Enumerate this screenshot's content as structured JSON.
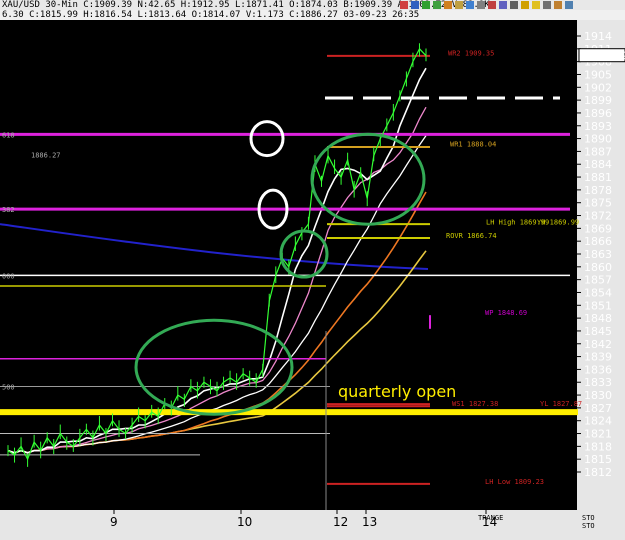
{
  "toolbar": {
    "ohlc": "XAU/USD 30-Min C:1909.39 N:42.65 H:1912.95 L:1871.41 O:1874.03 B:1909.39 A:1909.72 V:83.9K",
    "status": "6.30  C:1815.99 H:1816.54 L:1813.64 O:1814.07 V:1.173 C:1886.27 03-09-23 26:35",
    "icon_names": [
      "square-icon",
      "tile-icon",
      "arrow-icon",
      "check-icon",
      "refresh-icon",
      "notes-icon",
      "chart-icon",
      "settings-icon",
      "mail-icon",
      "grid-icon",
      "zoom-icon",
      "tag-icon",
      "sun-icon",
      "print-icon",
      "bell-icon",
      "window-icon"
    ]
  },
  "chart_data": {
    "type": "line",
    "symbol": "XAU/USD",
    "timeframe": "30-Min",
    "ylim": [
      1807,
      1917
    ],
    "y_ticks": [
      1914,
      1911,
      1908,
      1905,
      1902,
      1899,
      1896,
      1893,
      1890,
      1887,
      1884,
      1881,
      1878,
      1875,
      1872,
      1869,
      1866,
      1863,
      1860,
      1857,
      1854,
      1851,
      1848,
      1845,
      1842,
      1839,
      1836,
      1833,
      1830,
      1827,
      1824,
      1821,
      1818,
      1815,
      1812
    ],
    "last_price": "1909.39",
    "x_tick_labels": [
      "9",
      "10",
      "12",
      "13",
      "14"
    ],
    "close_series": [
      1817,
      1816,
      1818,
      1815,
      1819,
      1817,
      1820,
      1818,
      1821,
      1819,
      1818,
      1820,
      1822,
      1820,
      1823,
      1821,
      1824,
      1822,
      1821,
      1823,
      1825,
      1824,
      1826,
      1825,
      1828,
      1827,
      1830,
      1829,
      1832,
      1831,
      1833,
      1832,
      1831,
      1833,
      1834,
      1833,
      1835,
      1834,
      1833,
      1836,
      1852,
      1858,
      1862,
      1860,
      1865,
      1868,
      1870,
      1884,
      1880,
      1886,
      1883,
      1881,
      1885,
      1878,
      1882,
      1876,
      1886,
      1890,
      1893,
      1896,
      1900,
      1904,
      1908,
      1911,
      1909.39
    ],
    "levels": [
      {
        "label": "WR2 1909.35",
        "value": 1909.35,
        "color": "#cc2222"
      },
      {
        "label": "WR1 1888.04",
        "value": 1888.04,
        "color": "#d4a020"
      },
      {
        "label": "LH High 1869.99",
        "value": 1869.99,
        "color": "#cccc00"
      },
      {
        "label": "YH 1869.99",
        "value": 1869.99,
        "color": "#cccc00"
      },
      {
        "label": "ROVR 1866.74",
        "value": 1866.74,
        "color": "#cccc00"
      },
      {
        "label": "WP 1848.69",
        "value": 1848.69,
        "color": "#cc00cc"
      },
      {
        "label": "WS1 1827.38",
        "value": 1827.38,
        "color": "#cc2222"
      },
      {
        "label": "YL 1827.87",
        "value": 1827.87,
        "color": "#cc2222"
      },
      {
        "label": "LH Low 1809.23",
        "value": 1809.23,
        "color": "#cc2222"
      }
    ],
    "left_labels": [
      {
        "text": "618",
        "value": 1891
      },
      {
        "text": "1886.27",
        "value": 1886.3
      },
      {
        "text": "382",
        "value": 1873.5
      },
      {
        "text": "000",
        "value": 1858
      },
      {
        "text": "500",
        "value": 1832
      }
    ],
    "annotation": "quarterly open",
    "quarterly_open": 1826,
    "footer_labels": [
      "STO",
      "STO",
      "TRANGE"
    ],
    "colors": {
      "price": "#33ff33",
      "magenta_lines": "#dd22dd",
      "quarterly_line": "#ffee00",
      "circles_green": "#33aa55",
      "circles_white": "#ffffff",
      "ma_blue": "#2222cc",
      "ma_orange": "#ee7722",
      "ma_yellow": "#e8c840",
      "ma_white": "#ffffff",
      "ma_pink": "#ee88cc",
      "axis_bg": "#e6e6e6"
    }
  }
}
